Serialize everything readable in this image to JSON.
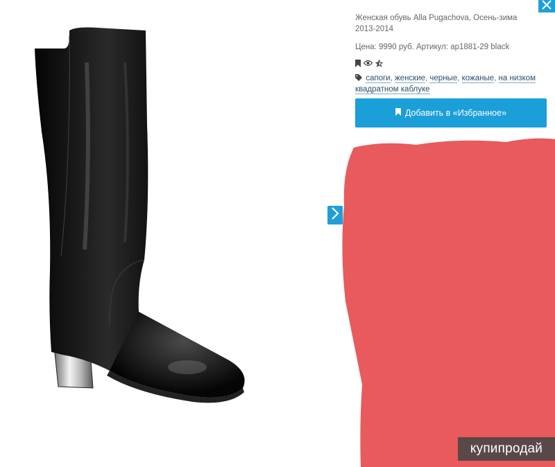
{
  "product": {
    "subtitle": "Женская обувь Alla Pugachova, Осень-зима 2013-2014",
    "price_line": "Цена: 9990 руб. Артикул: ap1881-29 black",
    "image_icon": "black-knee-high-boot",
    "tags_icon": "tag-icon",
    "tags": [
      "сапоги",
      "женские",
      "черные",
      "кожаные",
      "на низком",
      "квадратном каблуке"
    ]
  },
  "actions": {
    "icons": [
      "bookmark-icon",
      "eye-icon",
      "star-half-icon"
    ],
    "favorite_button": "Добавить в «Избранное»",
    "favorite_icon": "bookmark-icon",
    "next_icon": "chevron-right-icon",
    "close_icon": "close-icon"
  },
  "watermark": {
    "text": "купипродай"
  },
  "colors": {
    "accent": "#1a9fd8",
    "redaction": "#e85a5c",
    "tag_link": "#2b4f6b",
    "text_muted": "#666666"
  }
}
